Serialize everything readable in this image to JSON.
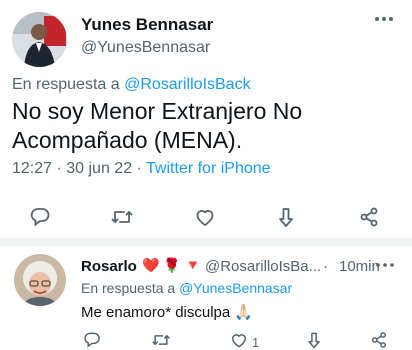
{
  "main_tweet": {
    "author_name": "Yunes Bennasar",
    "author_handle": "@YunesBennasar",
    "reply_prefix": "En respuesta a",
    "reply_handle": "@RosarilloIsBack",
    "text": "No soy Menor Extranjero No Acompañado (MENA).",
    "timestamp": "12:27 · 30 jun 22 · ",
    "source": "Twitter for iPhone",
    "actions": [
      "reply-icon",
      "retweet-icon",
      "like-icon",
      "bookmark-icon",
      "share-icon"
    ]
  },
  "reply_tweet": {
    "author_name": "Rosarlo",
    "emojis": [
      "❤️",
      "🌹",
      "🔻"
    ],
    "author_handle": "@RosarilloIsBa...",
    "separator": "·",
    "time_ago": "10min",
    "reply_prefix": "En respuesta a",
    "reply_handle": "@YunesBennasar",
    "text": "Me enamoro* disculpa 🙏🏻",
    "like_count": "1",
    "actions": [
      "reply-icon",
      "retweet-icon",
      "like-icon",
      "bookmark-icon",
      "share-icon"
    ]
  },
  "colors": {
    "text": "#0f1419",
    "secondary": "#536471",
    "link": "#1d9bf0",
    "divider": "#eff3f4"
  }
}
